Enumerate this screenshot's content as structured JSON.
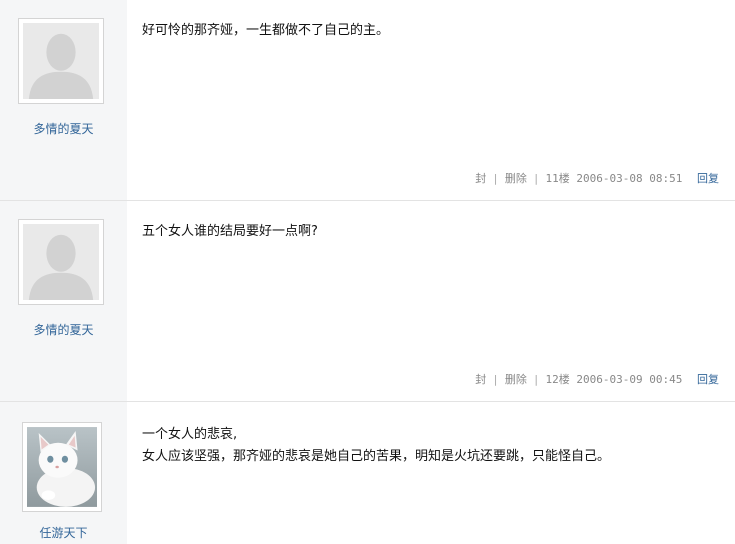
{
  "posts": [
    {
      "username": "多情的夏天",
      "lines": [
        "好可怜的那齐娅，一生都做不了自己的主。"
      ],
      "block_label": "封",
      "delete_label": "删除",
      "floor": "11楼",
      "timestamp": "2006-03-08 08:51",
      "reply_label": "回复"
    },
    {
      "username": "多情的夏天",
      "lines": [
        "五个女人谁的结局要好一点啊?"
      ],
      "block_label": "封",
      "delete_label": "删除",
      "floor": "12楼",
      "timestamp": "2006-03-09 00:45",
      "reply_label": "回复"
    },
    {
      "username": "任游天下",
      "lines": [
        "一个女人的悲哀,",
        "女人应该坚强，那齐娅的悲哀是她自己的苦果，明知是火坑还要跳，只能怪自己。"
      ]
    }
  ]
}
